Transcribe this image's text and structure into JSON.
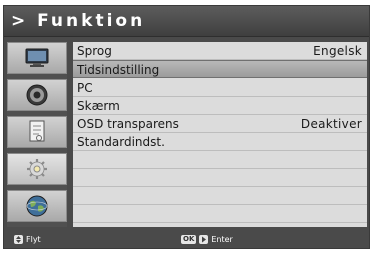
{
  "header": {
    "title": "> Funktion"
  },
  "sidebar": {
    "items": [
      {
        "icon": "tv-icon",
        "active": false
      },
      {
        "icon": "speaker-icon",
        "active": false
      },
      {
        "icon": "document-icon",
        "active": false
      },
      {
        "icon": "settings-gear-icon",
        "active": true
      },
      {
        "icon": "globe-icon",
        "active": false
      }
    ]
  },
  "menu": {
    "rows": [
      {
        "label": "Sprog",
        "value": "Engelsk"
      },
      {
        "label": "Tidsindstilling",
        "value": ""
      },
      {
        "label": "PC",
        "value": ""
      },
      {
        "label": "Skærm",
        "value": ""
      },
      {
        "label": "OSD transparens",
        "value": "Deaktiver"
      },
      {
        "label": "Standardindst.",
        "value": ""
      }
    ],
    "selected_index": 1
  },
  "footer": {
    "move_label": "Flyt",
    "ok_badge": "OK",
    "enter_label": "Enter"
  },
  "colors": {
    "panel": "#4a4a4a",
    "list_bg": "#dcdcdc",
    "selected_row": "#a8a8a8",
    "text": "#1a1a1a"
  }
}
